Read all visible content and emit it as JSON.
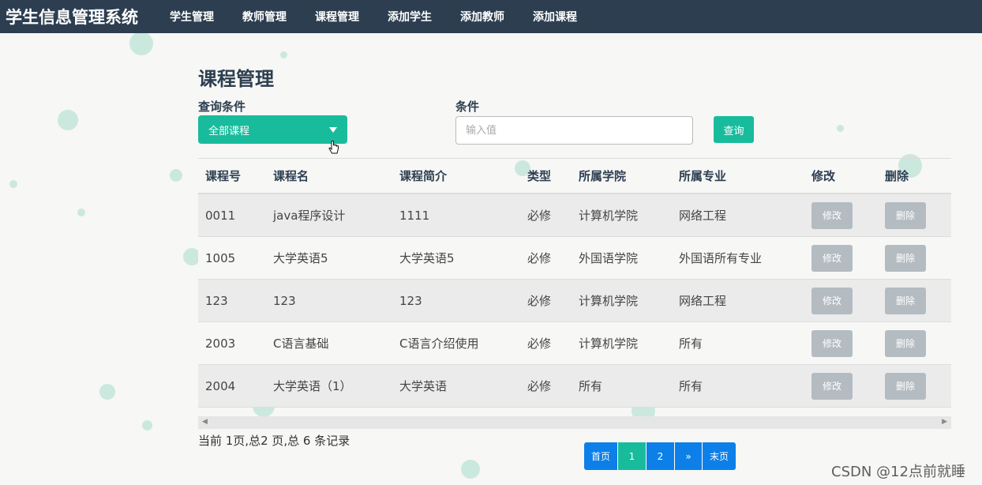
{
  "navbar": {
    "brand": "学生信息管理系统",
    "items": [
      "学生管理",
      "教师管理",
      "课程管理",
      "添加学生",
      "添加教师",
      "添加课程"
    ]
  },
  "page": {
    "title": "课程管理",
    "query_label": "查询条件",
    "condition_label": "条件",
    "select_value": "全部课程",
    "input_placeholder": "输入值",
    "query_button": "查询"
  },
  "table": {
    "headers": [
      "课程号",
      "课程名",
      "课程简介",
      "类型",
      "所属学院",
      "所属专业",
      "修改",
      "删除"
    ],
    "rows": [
      [
        "0011",
        "java程序设计",
        "1111",
        "必修",
        "计算机学院",
        "网络工程"
      ],
      [
        "1005",
        "大学英语5",
        "大学英语5",
        "必修",
        "外国语学院",
        "外国语所有专业"
      ],
      [
        "123",
        "123",
        "123",
        "必修",
        "计算机学院",
        "网络工程"
      ],
      [
        "2003",
        "C语言基础",
        "C语言介绍使用",
        "必修",
        "计算机学院",
        "所有"
      ],
      [
        "2004",
        "大学英语（1）",
        "大学英语",
        "必修",
        "所有",
        "所有"
      ]
    ],
    "edit_label": "修改",
    "delete_label": "删除"
  },
  "footer": {
    "summary": "当前 1页,总2 页,总 6 条记录",
    "pagination": [
      "首页",
      "1",
      "2",
      "»",
      "末页"
    ],
    "active_page": "1"
  },
  "watermark": "CSDN @12点前就睡",
  "colors": {
    "navbar": "#2c3e50",
    "accent": "#18bc9c",
    "page_button": "#0d7fe8",
    "action_button": "#b4bcc2"
  },
  "icons": {
    "select_arrow": "caret-down-icon",
    "cursor": "hand-pointer-icon",
    "scroll_left": "scroll-left-arrow-icon",
    "scroll_right": "scroll-right-arrow-icon"
  }
}
